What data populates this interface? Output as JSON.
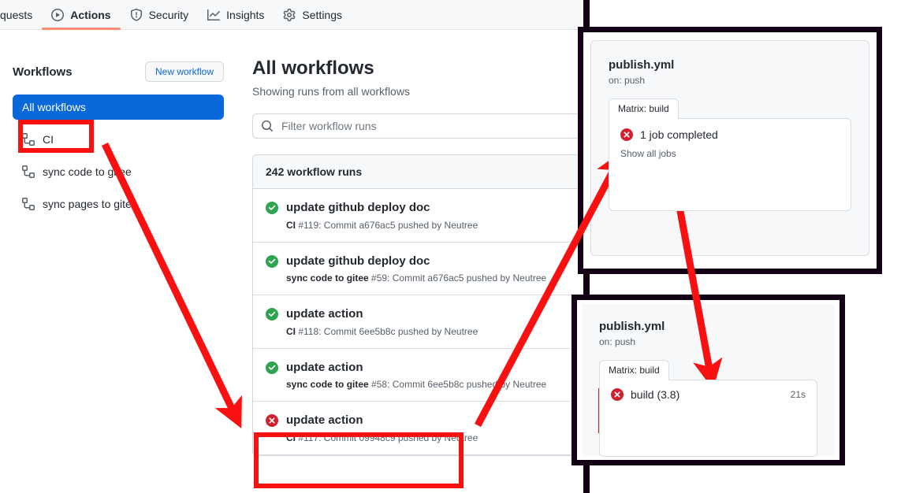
{
  "nav": {
    "tabs": [
      {
        "label": "quests",
        "icon": "pull-request-icon",
        "active": false,
        "truncated": true
      },
      {
        "label": "Actions",
        "icon": "play-circle-icon",
        "active": true
      },
      {
        "label": "Security",
        "icon": "shield-icon",
        "active": false
      },
      {
        "label": "Insights",
        "icon": "graph-icon",
        "active": false
      },
      {
        "label": "Settings",
        "icon": "gear-icon",
        "active": false
      }
    ]
  },
  "sidebar": {
    "heading": "Workflows",
    "new_workflow_label": "New workflow",
    "items": [
      {
        "label": "All workflows",
        "selected": true,
        "icon": null
      },
      {
        "label": "CI",
        "selected": false,
        "icon": "workflow-icon"
      },
      {
        "label": "sync code to gitee",
        "selected": false,
        "icon": "workflow-icon"
      },
      {
        "label": "sync pages to gitee",
        "selected": false,
        "icon": "workflow-icon"
      }
    ]
  },
  "main": {
    "title": "All workflows",
    "subtitle": "Showing runs from all workflows",
    "filter_placeholder": "Filter workflow runs",
    "filter_value": "",
    "runs_header": "242 workflow runs",
    "runs": [
      {
        "status": "success",
        "title": "update github deploy doc",
        "workflow": "CI",
        "meta": " #119: Commit a676ac5 pushed by Neutree"
      },
      {
        "status": "success",
        "title": "update github deploy doc",
        "workflow": "sync code to gitee",
        "meta": " #59: Commit a676ac5 pushed by Neutree"
      },
      {
        "status": "success",
        "title": "update action",
        "workflow": "CI",
        "meta": " #118: Commit 6ee5b8c pushed by Neutree"
      },
      {
        "status": "success",
        "title": "update action",
        "workflow": "sync code to gitee",
        "meta": " #58: Commit 6ee5b8c pushed by Neutree"
      },
      {
        "status": "failure",
        "title": "update action",
        "workflow": "CI",
        "meta": " #117: Commit 09948c9 pushed by Neutree"
      }
    ]
  },
  "shot_top": {
    "yml_title": "publish.yml",
    "yml_sub": "on: push",
    "matrix_tab": "Matrix: build",
    "job_status": "failure",
    "job_label": "1 job completed",
    "show_all_label": "Show all jobs"
  },
  "shot_bottom": {
    "yml_title": "publish.yml",
    "yml_sub": "on: push",
    "matrix_tab": "Matrix: build",
    "job_status": "failure",
    "job_label": "build (3.8)",
    "job_time": "21s"
  },
  "colors": {
    "annotation_red": "#f91010",
    "success_green": "#2da44e",
    "failure_red": "#cf222e",
    "accent_blue": "#0969da",
    "active_tab_underline": "#fd8c73",
    "panel_border_dark": "#140016"
  }
}
